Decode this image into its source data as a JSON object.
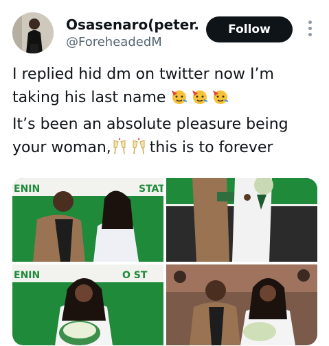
{
  "author": {
    "display_name": "Osasenaro(peter...",
    "handle": "@ForeheadedM",
    "avatar_icon": "avatar-photo"
  },
  "actions": {
    "follow_label": "Follow",
    "more_icon": "more-vertical-icon"
  },
  "tweet": {
    "line1": "I replied hid dm on twitter now I’m",
    "line2": "taking his last name",
    "line2_emojis": [
      "partying-face",
      "partying-face",
      "partying-face"
    ],
    "line3": "It’s been an absolute pleasure being",
    "line4_start": "your woman,",
    "line4_emojis": [
      "clinking-glasses",
      "clinking-glasses"
    ],
    "line4_end": "this is to forever"
  },
  "media": {
    "photos": [
      {
        "subject": "couple-standing-photo",
        "banner_text_left": "ENIN",
        "banner_text_right": "STAT"
      },
      {
        "subject": "couple-holding-hands-photo"
      },
      {
        "subject": "bride-with-bouquet-photo",
        "banner_text_left": "ENIN",
        "banner_text_right": "O ST"
      },
      {
        "subject": "couple-seated-photo"
      }
    ]
  },
  "colors": {
    "text": "#0f1419",
    "secondary_text": "#536471",
    "button": "#0f1419",
    "banner_green": "#1f8a3a"
  }
}
